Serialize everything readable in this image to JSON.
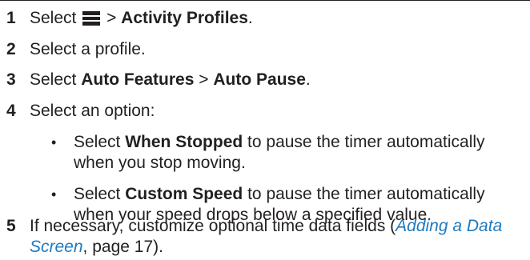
{
  "steps": [
    {
      "number": "1",
      "prefix": "Select",
      "icon": "menu-icon",
      "sep": ">",
      "bold": "Activity Profiles",
      "end": "."
    },
    {
      "number": "2",
      "text": "Select a profile."
    },
    {
      "number": "3",
      "prefix": "Select",
      "bold1": "Auto Features",
      "sep": ">",
      "bold2": "Auto Pause",
      "end": "."
    },
    {
      "number": "4",
      "text": "Select an option:"
    },
    {
      "number": "5",
      "text_before": "If necessary, customize optional time data fields (",
      "link_text": "Adding a Data Screen",
      "text_after": ", page 17)."
    }
  ],
  "bullets": [
    {
      "marker": "•",
      "prefix": "Select",
      "bold": "When Stopped",
      "rest_line1": "to pause the timer automatically",
      "line2": "when you stop moving."
    },
    {
      "marker": "•",
      "prefix": "Select",
      "bold": "Custom Speed",
      "rest_line1": "to pause the timer automatically",
      "line2": "when your speed drops below a specified value."
    }
  ],
  "colors": {
    "text": "#231f20",
    "link": "#1f7abf"
  }
}
